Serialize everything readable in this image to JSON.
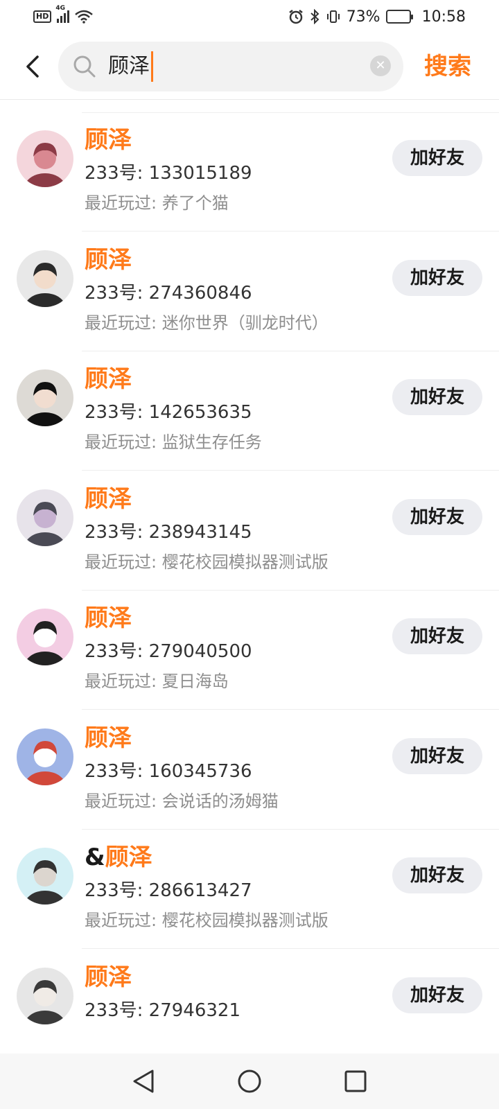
{
  "status_bar": {
    "hd_badge": "HD",
    "network": "4G",
    "battery_percent": "73%",
    "battery_level": 0.73,
    "time": "10:58"
  },
  "search": {
    "query": "顾泽",
    "action_label": "搜索"
  },
  "results": [
    {
      "prefix": "",
      "name": "顾泽",
      "uid_label": "233号: 133015189",
      "played_label": "最近玩过: 养了个猫",
      "button": "加好友",
      "avatar_palette": [
        "#f4d6dc",
        "#d98891",
        "#8c3b46"
      ]
    },
    {
      "prefix": "",
      "name": "顾泽",
      "uid_label": "233号: 274360846",
      "played_label": "最近玩过: 迷你世界（驯龙时代）",
      "button": "加好友",
      "avatar_palette": [
        "#e8e8e8",
        "#f2dccb",
        "#2b2b2b"
      ]
    },
    {
      "prefix": "",
      "name": "顾泽",
      "uid_label": "233号: 142653635",
      "played_label": "最近玩过: 监狱生存任务",
      "button": "加好友",
      "avatar_palette": [
        "#dddad5",
        "#f1ddd0",
        "#111111"
      ]
    },
    {
      "prefix": "",
      "name": "顾泽",
      "uid_label": "233号: 238943145",
      "played_label": "最近玩过: 樱花校园模拟器测试版",
      "button": "加好友",
      "avatar_palette": [
        "#e7e3ea",
        "#c7b2d1",
        "#4a4a55"
      ]
    },
    {
      "prefix": "",
      "name": "顾泽",
      "uid_label": "233号: 279040500",
      "played_label": "最近玩过: 夏日海岛",
      "button": "加好友",
      "avatar_palette": [
        "#f3cde3",
        "#ffffff",
        "#222222"
      ]
    },
    {
      "prefix": "",
      "name": "顾泽",
      "uid_label": "233号: 160345736",
      "played_label": "最近玩过: 会说话的汤姆猫",
      "button": "加好友",
      "avatar_palette": [
        "#9fb4e6",
        "#ffffff",
        "#d1483a"
      ]
    },
    {
      "prefix": "&",
      "name": "顾泽",
      "uid_label": "233号: 286613427",
      "played_label": "最近玩过: 樱花校园模拟器测试版",
      "button": "加好友",
      "avatar_palette": [
        "#d4f0f5",
        "#dcd6cf",
        "#333333"
      ]
    },
    {
      "prefix": "",
      "name": "顾泽",
      "uid_label": "233号: 27946321",
      "played_label": "",
      "button": "加好友",
      "avatar_palette": [
        "#e6e6e6",
        "#f0ebe6",
        "#3a3a3a"
      ]
    }
  ],
  "icons": {
    "back": "back-arrow-icon",
    "search": "search-icon",
    "clear": "clear-icon",
    "nav_back": "nav-back-triangle-icon",
    "nav_home": "nav-home-circle-icon",
    "nav_recent": "nav-recent-square-icon"
  },
  "colors": {
    "accent": "#ff7a1a",
    "button_bg": "#ecedf1",
    "secondary_text": "#8e8e8e"
  }
}
